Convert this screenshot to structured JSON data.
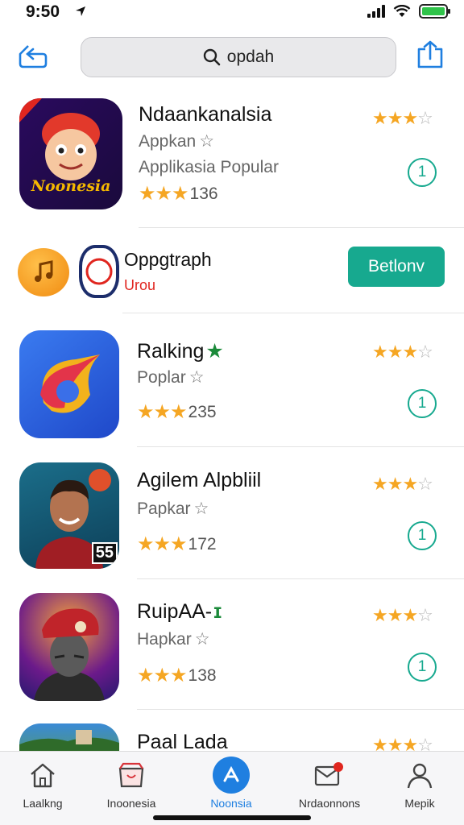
{
  "status_bar": {
    "time": "9:50"
  },
  "search": {
    "query": "opdah"
  },
  "apps": [
    {
      "title": "Ndaankanalsia",
      "subtitle": "Appkan",
      "subtitle2": "Applikasia Popular",
      "rating_count": "136",
      "get_label": "1"
    },
    {
      "title": "Ralking",
      "subtitle": "Poplar",
      "rating_count": "235",
      "get_label": "1"
    },
    {
      "title": "Agilem Alpbliil",
      "subtitle": "Papkar",
      "rating_count": "172",
      "get_label": "1"
    },
    {
      "title": "RuipAA-",
      "subtitle": "Hapkar",
      "rating_count": "138",
      "get_label": "1"
    },
    {
      "title": "Paal Lada"
    }
  ],
  "promo": {
    "title": "Oppgtraph",
    "subtitle": "Urou",
    "button_label": "Betlonv"
  },
  "app_icon_texts": {
    "first": "Noonesia",
    "third_badge": "55"
  },
  "tab_bar": {
    "tabs": [
      {
        "label": "Laalkng",
        "icon": "home-icon"
      },
      {
        "label": "Inoonesia",
        "icon": "store-icon"
      },
      {
        "label": "Noonsia",
        "icon": "app-store-icon"
      },
      {
        "label": "Nrdaonnons",
        "icon": "mail-icon"
      },
      {
        "label": "Mepik",
        "icon": "person-icon"
      }
    ]
  },
  "colors": {
    "accent_green": "#17a98f",
    "star": "#f5a623",
    "tab_active": "#1f7fe0"
  }
}
